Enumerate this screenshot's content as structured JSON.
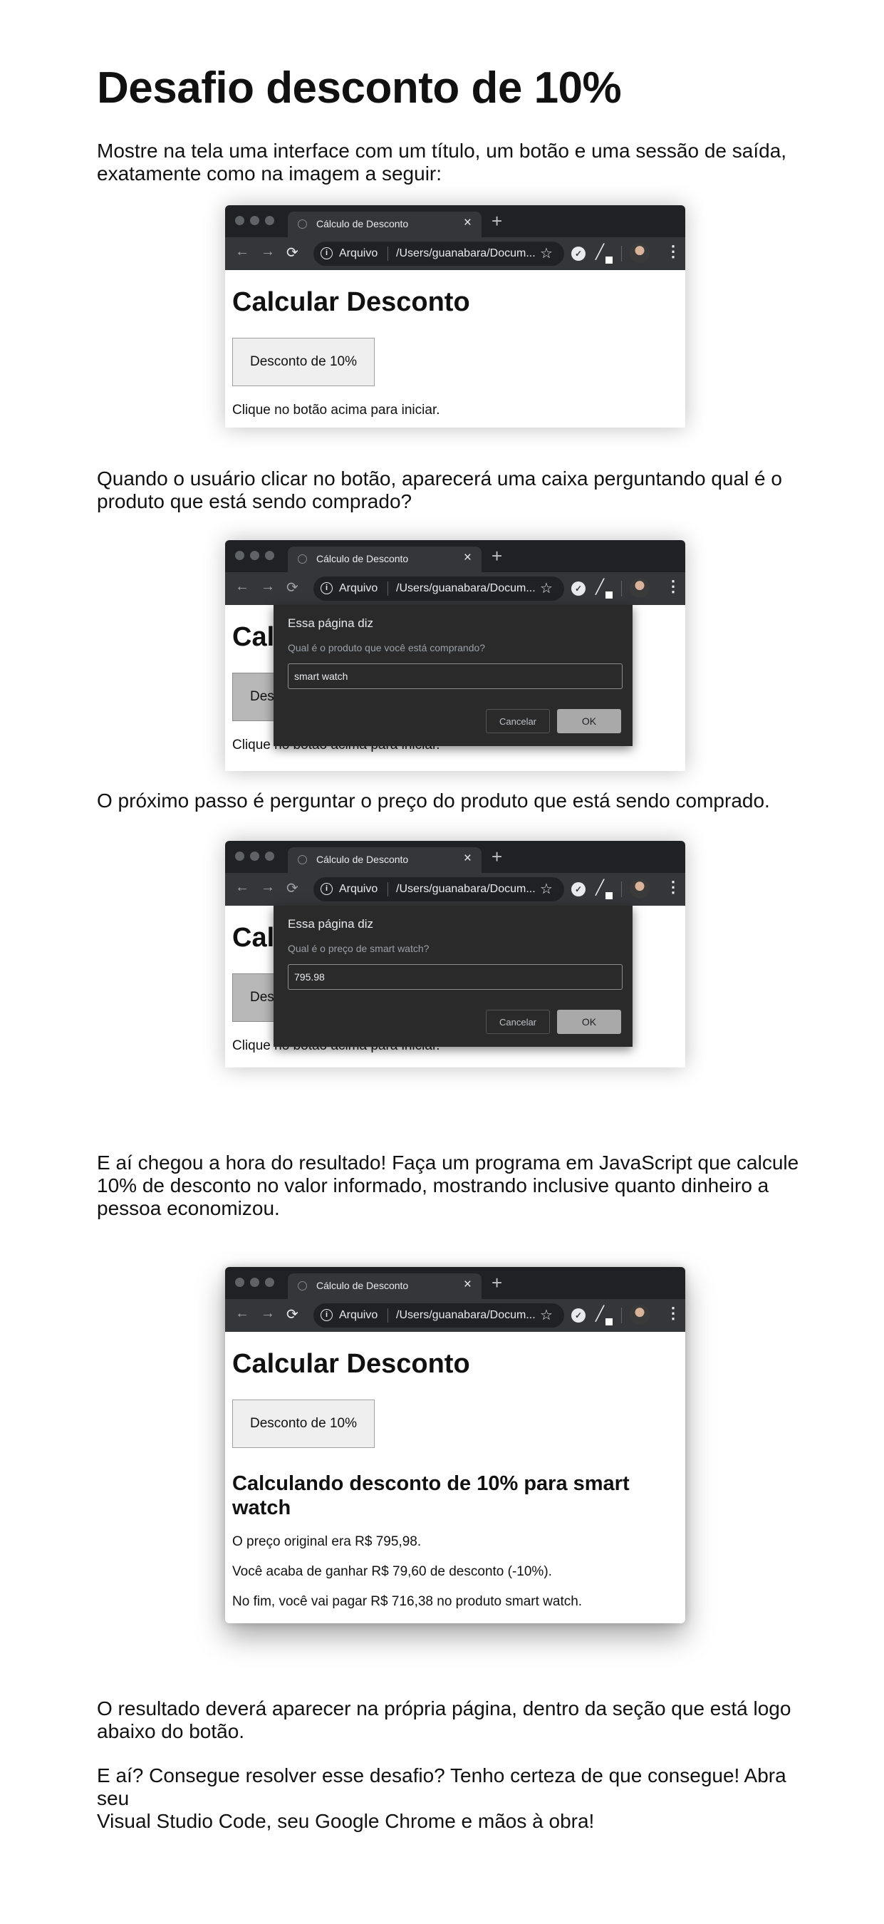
{
  "heading": "Desafio desconto de 10%",
  "paragraphs": {
    "p1_line1": "Mostre na tela uma interface com um título, um botão e uma sessão de saída,",
    "p1_line2": "exatamente como na imagem a seguir:",
    "p2_line1": "Quando o usuário clicar no botão, aparecerá uma caixa perguntando qual é o",
    "p2_line2": "produto que está sendo comprado?",
    "p3": "O próximo passo é perguntar o preço do produto que está sendo comprado.",
    "p4_line1": "E aí chegou a hora do resultado! Faça um programa em JavaScript que calcule",
    "p4_line2": "10% de desconto no valor informado, mostrando inclusive quanto dinheiro a",
    "p4_line3": "pessoa economizou.",
    "p5_line1": "O resultado deverá aparecer na própria página, dentro da seção que está logo",
    "p5_line2": "abaixo do botão.",
    "p6_line1": "E aí? Consegue resolver esse desafio? Tenho certeza de que consegue! Abra seu",
    "p6_line2": "Visual Studio Code, seu Google Chrome e mãos à obra!"
  },
  "browser": {
    "tab_title": "Cálculo de Desconto",
    "tab_close": "×",
    "new_tab": "+",
    "back": "←",
    "forward": "→",
    "reload": "⟳",
    "info": "i",
    "address_label": "Arquivo",
    "address_path": "/Users/guanabara/Docum...",
    "star": "☆",
    "menu": "⋮",
    "icons": [
      "globe-icon",
      "shield-icon",
      "pen-icon",
      "avatar"
    ]
  },
  "app": {
    "page_title": "Calcular Desconto",
    "button_label": "Desconto de 10%",
    "start_hint": "Clique no botão acima para iniciar."
  },
  "dialog1": {
    "header": "Essa página diz",
    "question": "Qual é o produto que você está comprando?",
    "input_value": "smart watch",
    "cancel": "Cancelar",
    "ok": "OK"
  },
  "dialog2": {
    "header": "Essa página diz",
    "question": "Qual é o preço de smart watch?",
    "input_value": "795.98",
    "cancel": "Cancelar",
    "ok": "OK"
  },
  "result": {
    "heading_line1": "Calculando desconto de 10% para smart",
    "heading_line2": "watch",
    "original": "O preço original era R$ 795,98.",
    "gain": "Você acaba de ganhar R$ 79,60 de desconto (-10%).",
    "final": "No fim, você vai pagar R$ 716,38 no produto smart watch."
  }
}
